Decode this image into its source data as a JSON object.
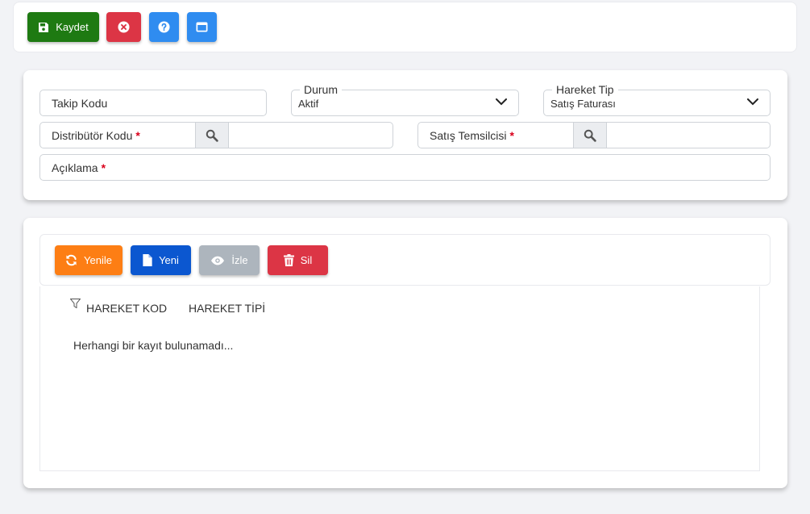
{
  "toolbar": {
    "save_label": "Kaydet",
    "colors": {
      "save": "#1e7a12",
      "close": "#dc3545",
      "help": "#2f8cf0",
      "window": "#2f8cf0"
    }
  },
  "form": {
    "tracking_code": {
      "label": "Takip Kodu"
    },
    "status": {
      "legend": "Durum",
      "value": "Aktif"
    },
    "movement_type": {
      "legend": "Hareket Tip",
      "value": "Satış Faturası"
    },
    "distributor_code": {
      "label": "Distribütör Kodu",
      "required": "*",
      "value": ""
    },
    "sales_rep": {
      "label": "Satış Temsilcisi",
      "required": "*",
      "value": ""
    },
    "description": {
      "label": "Açıklama",
      "required": "*"
    }
  },
  "grid": {
    "buttons": {
      "refresh": "Yenile",
      "new": "Yeni",
      "view": "İzle",
      "delete": "Sil"
    },
    "colors": {
      "refresh": "#fd7e14",
      "new": "#0b57d0",
      "view": "#adb5bd",
      "delete": "#dc3545"
    },
    "columns": [
      "HAREKET KOD",
      "HAREKET TİPİ"
    ],
    "empty_message": "Herhangi bir kayıt bulunamadı..."
  }
}
